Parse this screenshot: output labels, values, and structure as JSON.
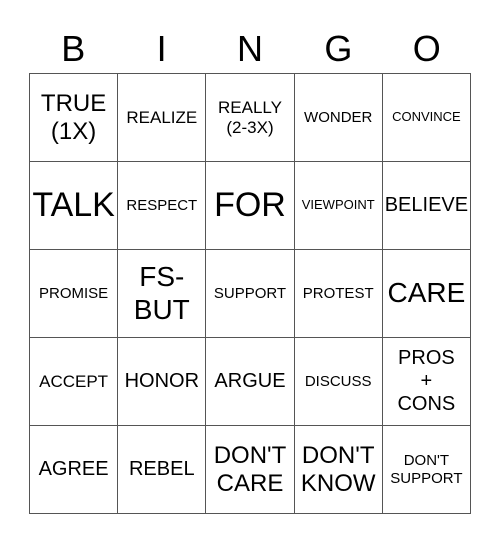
{
  "header": {
    "letters": [
      "B",
      "I",
      "N",
      "G",
      "O"
    ]
  },
  "board": {
    "rows": [
      [
        "TRUE\n(1X)",
        "REALIZE",
        "REALLY\n(2-3X)",
        "WONDER",
        "CONVINCE"
      ],
      [
        "TALK",
        "RESPECT",
        "FOR",
        "VIEWPOINT",
        "BELIEVE"
      ],
      [
        "PROMISE",
        "FS-\nBUT",
        "SUPPORT",
        "PROTEST",
        "CARE"
      ],
      [
        "ACCEPT",
        "HONOR",
        "ARGUE",
        "DISCUSS",
        "PROS\n+\nCONS"
      ],
      [
        "AGREE",
        "REBEL",
        "DON'T\nCARE",
        "DON'T\nKNOW",
        "DON'T\nSUPPORT"
      ]
    ]
  },
  "colors": {
    "text": "#000000",
    "grid_line": "#555555",
    "background": "#ffffff"
  }
}
